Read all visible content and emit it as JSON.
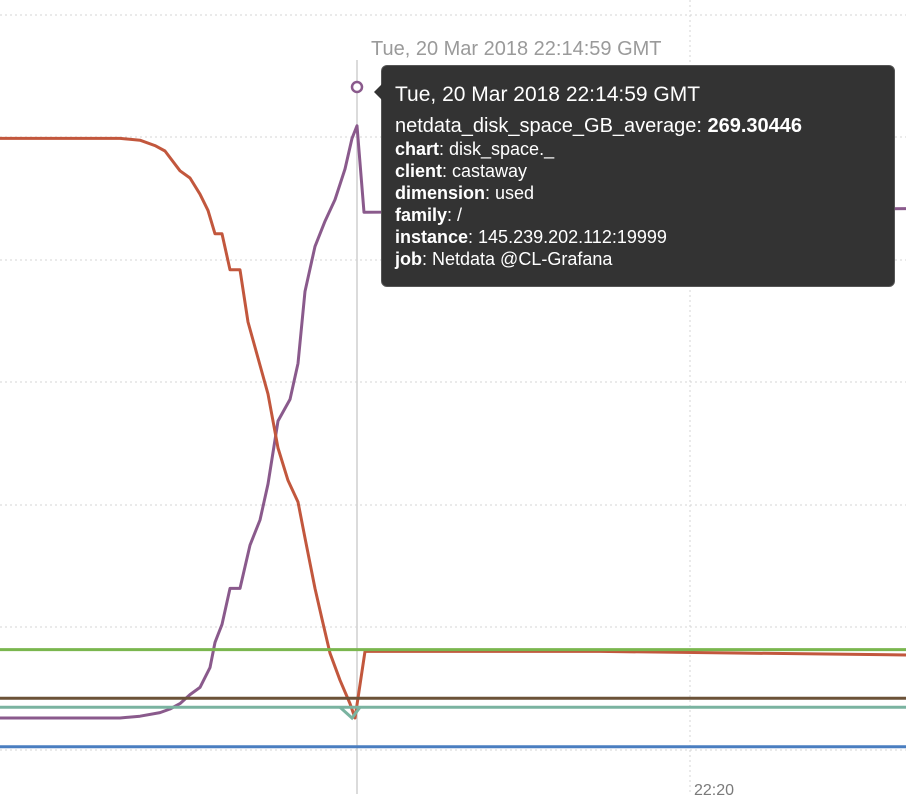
{
  "chart_data": {
    "type": "line",
    "grid": true,
    "x_tick_visible": "22:20",
    "crosshair_time": "Tue, 20 Mar 2018 22:14:59 GMT",
    "tooltip": {
      "title": "Tue, 20 Mar 2018 22:14:59 GMT",
      "metric": "netdata_disk_space_GB_average",
      "value": "269.30446",
      "rows": [
        {
          "key": "chart",
          "value": "disk_space._"
        },
        {
          "key": "client",
          "value": "castaway"
        },
        {
          "key": "dimension",
          "value": "used"
        },
        {
          "key": "family",
          "value": "/"
        },
        {
          "key": "instance",
          "value": "145.239.202.112:19999"
        },
        {
          "key": "job",
          "value": "Netdata @CL-Grafana"
        }
      ]
    },
    "series": [
      {
        "color": "#8a5a8c",
        "points": [
          [
            0,
            0
          ],
          [
            120,
            0
          ],
          [
            140,
            1
          ],
          [
            160,
            3
          ],
          [
            170,
            5
          ],
          [
            180,
            8
          ],
          [
            190,
            13
          ],
          [
            200,
            17
          ],
          [
            210,
            28
          ],
          [
            215,
            42
          ],
          [
            222,
            52
          ],
          [
            230,
            72
          ],
          [
            240,
            72
          ],
          [
            250,
            96
          ],
          [
            260,
            110
          ],
          [
            268,
            130
          ],
          [
            278,
            165
          ],
          [
            290,
            177
          ],
          [
            298,
            197
          ],
          [
            305,
            237
          ],
          [
            315,
            262
          ],
          [
            325,
            276
          ],
          [
            335,
            288
          ],
          [
            345,
            305
          ],
          [
            352,
            322
          ],
          [
            357,
            329
          ],
          [
            364,
            281
          ],
          [
            906,
            283
          ]
        ]
      },
      {
        "color": "#c2573d",
        "points": [
          [
            0,
            322
          ],
          [
            120,
            322
          ],
          [
            140,
            321
          ],
          [
            155,
            318
          ],
          [
            165,
            315
          ],
          [
            180,
            304
          ],
          [
            190,
            300
          ],
          [
            200,
            291
          ],
          [
            208,
            282
          ],
          [
            215,
            269
          ],
          [
            222,
            269
          ],
          [
            230,
            249
          ],
          [
            240,
            249
          ],
          [
            248,
            220
          ],
          [
            258,
            200
          ],
          [
            268,
            180
          ],
          [
            278,
            150
          ],
          [
            288,
            132
          ],
          [
            298,
            120
          ],
          [
            305,
            100
          ],
          [
            315,
            72
          ],
          [
            322,
            55
          ],
          [
            330,
            36
          ],
          [
            340,
            21
          ],
          [
            350,
            8
          ],
          [
            355,
            0
          ],
          [
            365,
            37
          ],
          [
            600,
            37
          ],
          [
            906,
            35
          ]
        ]
      },
      {
        "color": "#7ab64e",
        "value": 38
      },
      {
        "color": "#7ab3a0",
        "value": 6
      },
      {
        "color": "#6b5238",
        "value": 11
      },
      {
        "color": "#4a7ec0",
        "value": -16
      }
    ]
  }
}
